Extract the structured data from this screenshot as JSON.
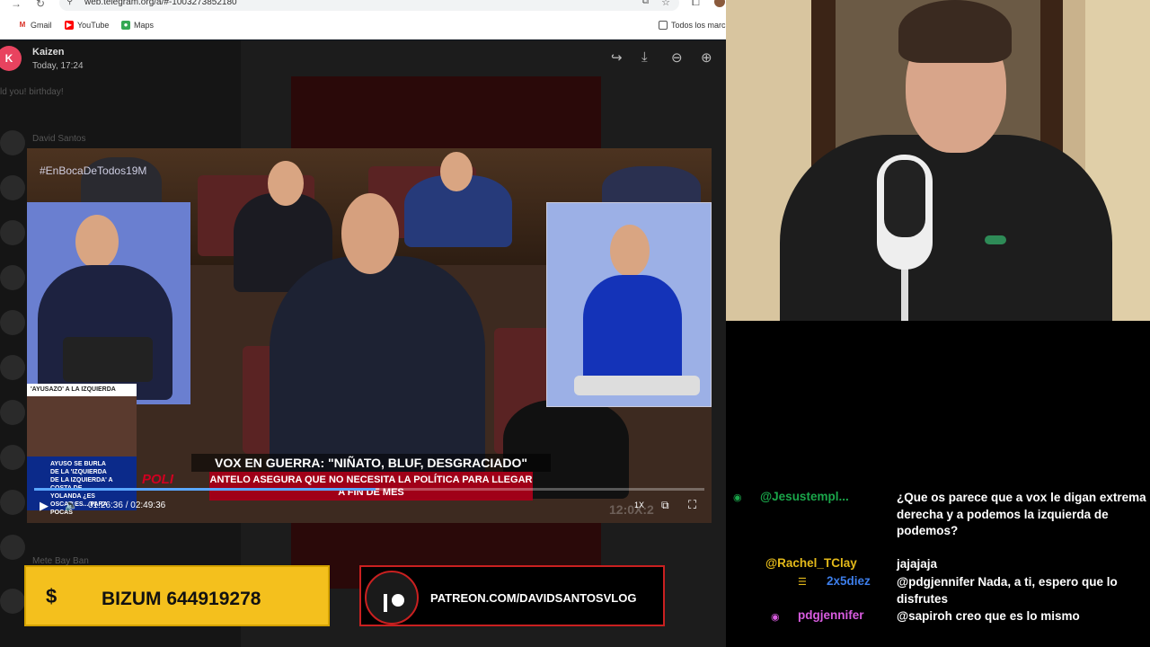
{
  "browser": {
    "url": "web.telegram.org/a/#-1003273852180",
    "bookmarks": [
      {
        "label": "Gmail",
        "icon": "gmail-icon"
      },
      {
        "label": "YouTube",
        "icon": "youtube-icon"
      },
      {
        "label": "Maps",
        "icon": "maps-icon"
      }
    ],
    "all_bookmarks_label": "Todos los marc"
  },
  "viewer": {
    "sender_initial": "K",
    "sender_name": "Kaizen",
    "timestamp": "Today, 17:24",
    "dim_text_1": "ld you! birthday!",
    "dim_text_2": "David Santos",
    "dim_text_3": "Mete Bay Ban"
  },
  "video": {
    "hashtag": "#EnBocaDeTodos19M",
    "small_ticker": "'AYUSAZO' A LA IZQUIERDA",
    "small_caption": "AYUSO SE BURLA DE LA 'IZQUIERDA DE LA IZQUIERDA' A COSTA DE YOLANDA ¿ES OSCAR ES... PARA POCAS",
    "headline": "VOX EN GUERRA: \"NIÑATO, BLUF, DESGRACIADO\"",
    "subheadline": "ANTELO ASEGURA QUE NO NECESITA LA POLÍTICA PARA LLEGAR A FIN DE MES",
    "pol_text": "POLI",
    "time_current": "01:26:36",
    "time_total": "02:49:36",
    "time_display": "01:26:36 / 02:49:36",
    "speed": "1X",
    "ghost_clock": "12:0X:2",
    "progress": 0.51
  },
  "banners": {
    "bizum_symbol": "$",
    "bizum_text": "BIZUM 644919278",
    "patreon_text": "PATREON.COM/DAVIDSANTOSVLOG",
    "bizum_color": "#f4c01d",
    "patreon_border": "#c92020"
  },
  "chat": {
    "messages": [
      {
        "user": "@Jesustempl...",
        "user_color": "#1aa64a",
        "badge_icon": "eye-icon",
        "text": "¿Que os parece que a vox le digan extrema derecha y a podemos la izquierda de podemos?"
      },
      {
        "user": "@Rachel_TClay",
        "user_color": "#e3b91a",
        "badge_icon": "",
        "text": "jajajaja"
      },
      {
        "user": "2x5diez",
        "user_color": "#3d7eea",
        "badge_icon": "stack-icon",
        "text": "@pdgjennifer Nada, a ti, espero que lo disfrutes"
      },
      {
        "user": "pdgjennifer",
        "user_color": "#d95ce0",
        "badge_icon": "eye-icon",
        "text": "@sapiroh creo que es lo mismo"
      }
    ]
  }
}
